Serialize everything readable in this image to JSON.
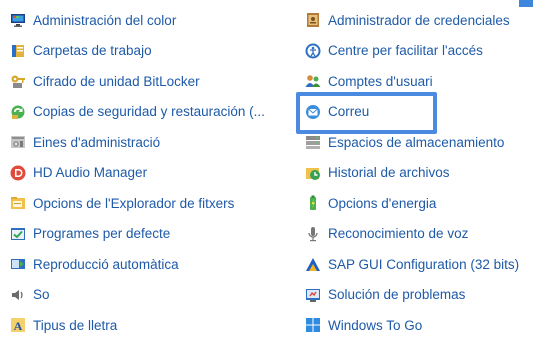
{
  "left_items": [
    {
      "label": "Administración del color",
      "icon": "monitor-color-icon"
    },
    {
      "label": "Carpetas de trabajo",
      "icon": "work-folders-icon"
    },
    {
      "label": "Cifrado de unidad BitLocker",
      "icon": "bitlocker-key-icon"
    },
    {
      "label": "Copias de seguridad y restauración (...",
      "icon": "backup-restore-icon"
    },
    {
      "label": "Eines d'administració",
      "icon": "admin-tools-icon"
    },
    {
      "label": "HD Audio Manager",
      "icon": "hd-audio-icon"
    },
    {
      "label": "Opcions de l'Explorador de fitxers",
      "icon": "folder-options-icon"
    },
    {
      "label": "Programes per defecte",
      "icon": "default-programs-icon"
    },
    {
      "label": "Reproducció automàtica",
      "icon": "autoplay-icon"
    },
    {
      "label": "So",
      "icon": "speaker-icon"
    },
    {
      "label": "Tipus de lletra",
      "icon": "fonts-icon"
    }
  ],
  "right_items": [
    {
      "label": "Administrador de credenciales",
      "icon": "credential-manager-icon"
    },
    {
      "label": "Centre per facilitar l'accés",
      "icon": "ease-of-access-icon"
    },
    {
      "label": "Comptes d'usuari",
      "icon": "user-accounts-icon"
    },
    {
      "label": "Correu",
      "icon": "mail-icon"
    },
    {
      "label": "Espacios de almacenamiento",
      "icon": "storage-spaces-icon"
    },
    {
      "label": "Historial de archivos",
      "icon": "file-history-icon"
    },
    {
      "label": "Opcions d'energia",
      "icon": "power-options-icon"
    },
    {
      "label": "Reconocimiento de voz",
      "icon": "microphone-icon"
    },
    {
      "label": "SAP GUI Configuration (32 bits)",
      "icon": "sap-gui-icon"
    },
    {
      "label": "Solución de problemas",
      "icon": "troubleshooting-icon"
    },
    {
      "label": "Windows To Go",
      "icon": "windows-to-go-icon"
    }
  ],
  "highlighted_item": "Correu",
  "colors": {
    "link": "#1e5aa8",
    "highlight": "#4a8ae0"
  }
}
